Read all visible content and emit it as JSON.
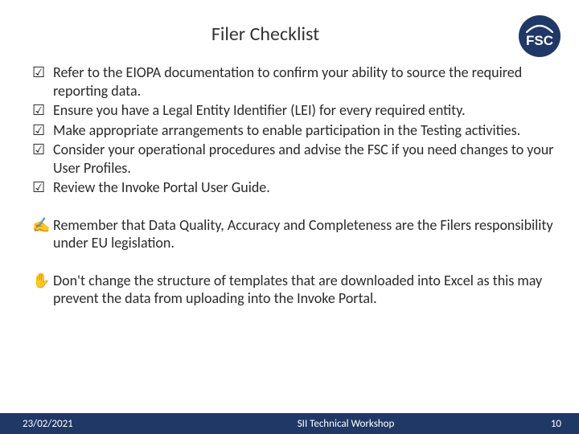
{
  "title": "Filer Checklist",
  "logo_label": "FSC",
  "checklist": [
    "Refer to the EIOPA documentation to confirm your ability to source the required reporting data.",
    "Ensure you have a Legal Entity Identifier (LEI) for every required entity.",
    "Make appropriate arrangements to enable participation in the Testing activities.",
    "Consider your operational procedures and advise the FSC if you need changes to your User Profiles.",
    "Review the Invoke Portal User Guide."
  ],
  "reminder": [
    "Remember that Data Quality, Accuracy and Completeness are the Filers responsibility under EU legislation."
  ],
  "warning": [
    "Don't change the structure of templates that are downloaded into Excel as this may prevent the data from uploading into the Invoke Portal."
  ],
  "footer": {
    "date": "23/02/2021",
    "center": "SII Technical Workshop",
    "page": "10"
  }
}
